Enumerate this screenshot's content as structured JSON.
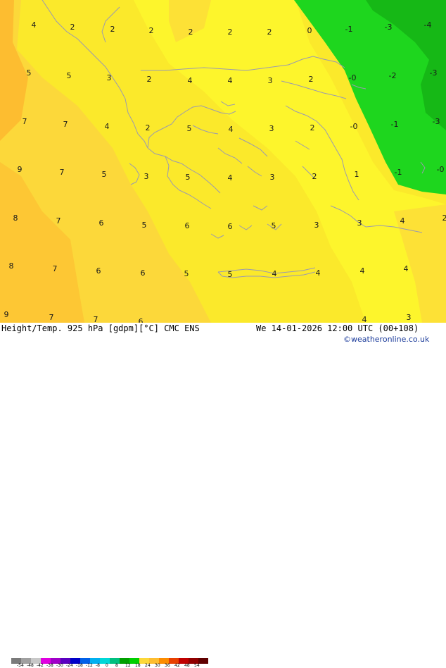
{
  "map": {
    "title": "Height/Temp. 925 hPa [gdpm][°C] CMC ENS",
    "valid_time": "We 14-01-2026 12:00 UTC (00+108)",
    "credit": "©weatheronline.co.uk",
    "colors": {
      "very_light_orange": "#fdbd30",
      "light_orange": "#fcd83a",
      "yellow": "#fbe92b",
      "bright_yellow": "#fdf52c",
      "light_green": "#1ed61e",
      "green": "#16b816",
      "coastline": "#9a9ab0",
      "label": "#1a1a1a"
    },
    "values": [
      {
        "t": "4",
        "c": 48,
        "r": 35
      },
      {
        "t": "2",
        "c": 103,
        "r": 38
      },
      {
        "t": "2",
        "c": 160,
        "r": 41
      },
      {
        "t": "2",
        "c": 215,
        "r": 43
      },
      {
        "t": "2",
        "c": 271,
        "r": 45
      },
      {
        "t": "2",
        "c": 327,
        "r": 45
      },
      {
        "t": "2",
        "c": 383,
        "r": 45
      },
      {
        "t": "0",
        "c": 440,
        "r": 43
      },
      {
        "t": "-1",
        "c": 496,
        "r": 41
      },
      {
        "t": "-3",
        "c": 552,
        "r": 38
      },
      {
        "t": "-4",
        "c": 608,
        "r": 35
      },
      {
        "t": "5",
        "c": 41,
        "r": 103
      },
      {
        "t": "5",
        "c": 98,
        "r": 107
      },
      {
        "t": "3",
        "c": 155,
        "r": 110
      },
      {
        "t": "2",
        "c": 212,
        "r": 112
      },
      {
        "t": "4",
        "c": 270,
        "r": 114
      },
      {
        "t": "4",
        "c": 327,
        "r": 114
      },
      {
        "t": "3",
        "c": 384,
        "r": 114
      },
      {
        "t": "2",
        "c": 442,
        "r": 112
      },
      {
        "t": "-0",
        "c": 501,
        "r": 110
      },
      {
        "t": "-2",
        "c": 558,
        "r": 107
      },
      {
        "t": "-3",
        "c": 616,
        "r": 103
      },
      {
        "t": "7",
        "c": 35,
        "r": 172
      },
      {
        "t": "7",
        "c": 93,
        "r": 176
      },
      {
        "t": "4",
        "c": 152,
        "r": 179
      },
      {
        "t": "2",
        "c": 210,
        "r": 181
      },
      {
        "t": "5",
        "c": 269,
        "r": 182
      },
      {
        "t": "4",
        "c": 328,
        "r": 183
      },
      {
        "t": "3",
        "c": 386,
        "r": 182
      },
      {
        "t": "2",
        "c": 444,
        "r": 181
      },
      {
        "t": "-0",
        "c": 503,
        "r": 179
      },
      {
        "t": "-1",
        "c": 561,
        "r": 176
      },
      {
        "t": "-3",
        "c": 620,
        "r": 172
      },
      {
        "t": "9",
        "c": 28,
        "r": 240
      },
      {
        "t": "7",
        "c": 88,
        "r": 244
      },
      {
        "t": "5",
        "c": 148,
        "r": 247
      },
      {
        "t": "3",
        "c": 208,
        "r": 250
      },
      {
        "t": "5",
        "c": 267,
        "r": 251
      },
      {
        "t": "4",
        "c": 327,
        "r": 252
      },
      {
        "t": "3",
        "c": 387,
        "r": 251
      },
      {
        "t": "2",
        "c": 447,
        "r": 250
      },
      {
        "t": "1",
        "c": 507,
        "r": 247
      },
      {
        "t": "-1",
        "c": 566,
        "r": 244
      },
      {
        "t": "-0",
        "c": 626,
        "r": 240
      },
      {
        "t": "8",
        "c": 22,
        "r": 309
      },
      {
        "t": "7",
        "c": 83,
        "r": 313
      },
      {
        "t": "6",
        "c": 144,
        "r": 316
      },
      {
        "t": "5",
        "c": 205,
        "r": 319
      },
      {
        "t": "6",
        "c": 266,
        "r": 320
      },
      {
        "t": "6",
        "c": 327,
        "r": 321
      },
      {
        "t": "5",
        "c": 389,
        "r": 320
      },
      {
        "t": "3",
        "c": 450,
        "r": 319
      },
      {
        "t": "3",
        "c": 511,
        "r": 316
      },
      {
        "t": "4",
        "c": 572,
        "r": 313
      },
      {
        "t": "2",
        "c": 632,
        "r": 309
      },
      {
        "t": "8",
        "c": 16,
        "r": 377
      },
      {
        "t": "7",
        "c": 78,
        "r": 381
      },
      {
        "t": "6",
        "c": 140,
        "r": 384
      },
      {
        "t": "6",
        "c": 203,
        "r": 387
      },
      {
        "t": "5",
        "c": 265,
        "r": 388
      },
      {
        "t": "5",
        "c": 327,
        "r": 389
      },
      {
        "t": "4",
        "c": 390,
        "r": 388
      },
      {
        "t": "4",
        "c": 452,
        "r": 387
      },
      {
        "t": "4",
        "c": 515,
        "r": 384
      },
      {
        "t": "4",
        "c": 577,
        "r": 381
      },
      {
        "t": "9",
        "c": 9,
        "r": 446
      },
      {
        "t": "7",
        "c": 73,
        "r": 450
      },
      {
        "t": "7",
        "c": 136,
        "r": 453
      },
      {
        "t": "6",
        "c": 200,
        "r": 456
      },
      {
        "t": "4",
        "c": 518,
        "r": 453
      },
      {
        "t": "3",
        "c": 581,
        "r": 450
      }
    ],
    "legend": {
      "ticks": [
        "-54",
        "-48",
        "-42",
        "-38",
        "-30",
        "-24",
        "-18",
        "-12",
        "-8",
        "0",
        "8",
        "12",
        "18",
        "24",
        "30",
        "36",
        "42",
        "48",
        "54"
      ],
      "colors": [
        "#7a7a7a",
        "#a0a0a0",
        "#c8c8c8",
        "#e000e0",
        "#a000c8",
        "#5a00c0",
        "#0000c8",
        "#0060e8",
        "#00b0f0",
        "#00d8d8",
        "#00c080",
        "#00a000",
        "#00d000",
        "#fcd83a",
        "#fdbd30",
        "#fc8c00",
        "#e84000",
        "#c00000",
        "#900000",
        "#600000"
      ]
    }
  }
}
